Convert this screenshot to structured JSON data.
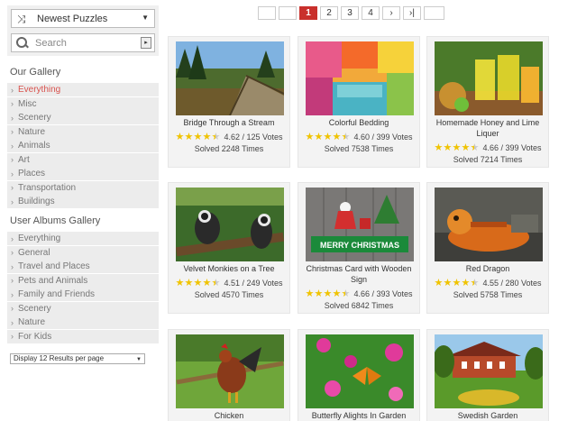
{
  "sort": {
    "label": "Newest Puzzles",
    "icon": "shuffle-icon"
  },
  "search": {
    "placeholder": "Search"
  },
  "our_gallery": {
    "title": "Our Gallery",
    "items": [
      "Everything",
      "Misc",
      "Scenery",
      "Nature",
      "Animals",
      "Art",
      "Places",
      "Transportation",
      "Buildings"
    ],
    "active": 0
  },
  "user_gallery": {
    "title": "User Albums Gallery",
    "items": [
      "Everything",
      "General",
      "Travel and Places",
      "Pets and Animals",
      "Family and Friends",
      "Scenery",
      "Nature",
      "For Kids"
    ]
  },
  "per_page": {
    "label": "Display 12 Results per page"
  },
  "pagination": {
    "pages": [
      "1",
      "2",
      "3",
      "4"
    ],
    "current": "1"
  },
  "puzzles": [
    {
      "title": "Bridge Through a Stream",
      "rating": 4.62,
      "rating_text": "4.62 / 125 Votes",
      "solved": "Solved 2248 Times"
    },
    {
      "title": "Colorful Bedding",
      "rating": 4.6,
      "rating_text": "4.60 / 399 Votes",
      "solved": "Solved 7538 Times"
    },
    {
      "title": "Homemade Honey and Lime Liquer",
      "rating": 4.66,
      "rating_text": "4.66 / 399 Votes",
      "solved": "Solved 7214 Times"
    },
    {
      "title": "Velvet Monkies on a Tree",
      "rating": 4.51,
      "rating_text": "4.51 / 249 Votes",
      "solved": "Solved 4570 Times"
    },
    {
      "title": "Christmas Card with Wooden Sign",
      "rating": 4.66,
      "rating_text": "4.66 / 393 Votes",
      "solved": "Solved 6842 Times"
    },
    {
      "title": "Red Dragon",
      "rating": 4.55,
      "rating_text": "4.55 / 280 Votes",
      "solved": "Solved 5758 Times"
    },
    {
      "title": "Chicken"
    },
    {
      "title": "Butterfly Alights In Garden"
    },
    {
      "title": "Swedish Garden"
    }
  ],
  "thumb_image_text": {
    "christmas_sign": "MERRY CHRISTMAS"
  },
  "colors": {
    "accent": "#c9302c",
    "star": "#f0c300",
    "panel": "#f3f3f3"
  }
}
